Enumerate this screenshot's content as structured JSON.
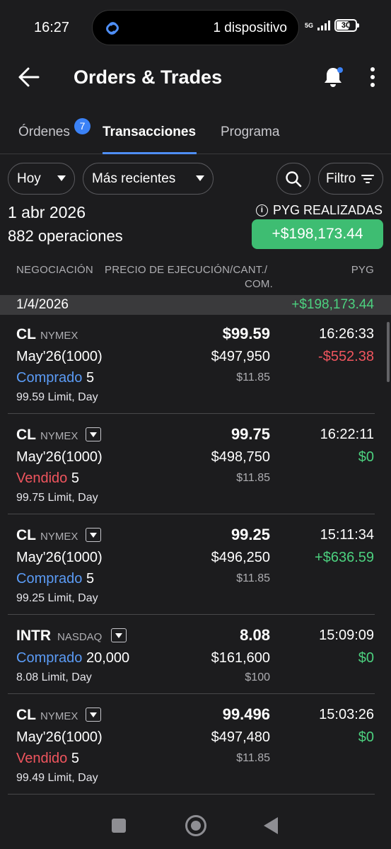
{
  "status_bar": {
    "time": "16:27",
    "island_text": "1 dispositivo",
    "network": "5G",
    "battery": "30"
  },
  "header": {
    "title": "Orders & Trades"
  },
  "tabs": [
    {
      "label": "Órdenes",
      "badge": "7"
    },
    {
      "label": "Transacciones",
      "active": true
    },
    {
      "label": "Programa"
    }
  ],
  "filters": {
    "period": "Hoy",
    "sort": "Más recientes",
    "filter_label": "Filtro"
  },
  "summary": {
    "date": "1 abr 2026",
    "count": "882 operaciones",
    "realized_label": "PYG REALIZADAS",
    "realized_value": "+$198,173.44"
  },
  "columns": {
    "trading": "NEGOCIACIÓN",
    "price_line1": "PRECIO DE EJECUCIÓN/CANT./",
    "price_line2": "COM.",
    "pnl": "PYG"
  },
  "group": {
    "date": "1/4/2026",
    "total": "+$198,173.44"
  },
  "trades": [
    {
      "symbol": "CL",
      "exchange": "NYMEX",
      "contract": "May'26(1000)",
      "side": "Comprado",
      "qty": "5",
      "order_type": "99.59 Limit, Day",
      "price": "$99.59",
      "amount": "$497,950",
      "commission": "$11.85",
      "time": "16:26:33",
      "pnl": "-$552.38"
    },
    {
      "symbol": "CL",
      "exchange": "NYMEX",
      "contract": "May'26(1000)",
      "side": "Vendido",
      "qty": "5",
      "order_type": "99.75 Limit, Day",
      "price": "99.75",
      "amount": "$498,750",
      "commission": "$11.85",
      "time": "16:22:11",
      "pnl": "$0"
    },
    {
      "symbol": "CL",
      "exchange": "NYMEX",
      "contract": "May'26(1000)",
      "side": "Comprado",
      "qty": "5",
      "order_type": "99.25 Limit, Day",
      "price": "99.25",
      "amount": "$496,250",
      "commission": "$11.85",
      "time": "15:11:34",
      "pnl": "+$636.59"
    },
    {
      "symbol": "INTR",
      "exchange": "NASDAQ",
      "contract": "",
      "side": "Comprado",
      "qty": "20,000",
      "order_type": "8.08 Limit, Day",
      "price": "8.08",
      "amount": "$161,600",
      "commission": "$100",
      "time": "15:09:09",
      "pnl": "$0"
    },
    {
      "symbol": "CL",
      "exchange": "NYMEX",
      "contract": "May'26(1000)",
      "side": "Vendido",
      "qty": "5",
      "order_type": "99.49 Limit, Day",
      "price": "99.496",
      "amount": "$497,480",
      "commission": "$11.85",
      "time": "15:03:26",
      "pnl": "$0"
    }
  ],
  "colors": {
    "accent": "#3b82f6",
    "buy": "#5b9bf5",
    "sell": "#f0555e",
    "positive": "#4cd17f",
    "realized_badge": "#3ebd72",
    "background": "#1c1c1e"
  },
  "icons": [
    "back-arrow-icon",
    "bell-icon",
    "more-vertical-icon",
    "search-icon",
    "filter-icon",
    "info-icon",
    "dropdown-icon",
    "link-icon"
  ]
}
